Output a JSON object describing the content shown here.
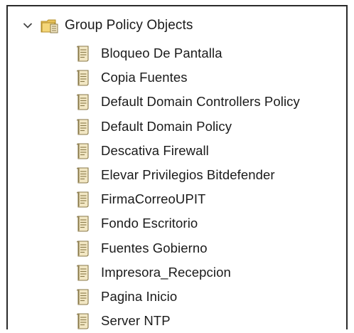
{
  "tree": {
    "root": {
      "label": "Group Policy Objects",
      "expanded": true,
      "icon": "folder-gpo-icon"
    },
    "items": [
      {
        "label": "Bloqueo De Pantalla",
        "icon": "gpo-document-icon"
      },
      {
        "label": "Copia Fuentes",
        "icon": "gpo-document-icon"
      },
      {
        "label": "Default Domain Controllers Policy",
        "icon": "gpo-document-icon"
      },
      {
        "label": "Default Domain Policy",
        "icon": "gpo-document-icon"
      },
      {
        "label": "Descativa Firewall",
        "icon": "gpo-document-icon"
      },
      {
        "label": "Elevar Privilegios Bitdefender",
        "icon": "gpo-document-icon"
      },
      {
        "label": "FirmaCorreoUPIT",
        "icon": "gpo-document-icon"
      },
      {
        "label": "Fondo Escritorio",
        "icon": "gpo-document-icon"
      },
      {
        "label": "Fuentes Gobierno",
        "icon": "gpo-document-icon"
      },
      {
        "label": "Impresora_Recepcion",
        "icon": "gpo-document-icon"
      },
      {
        "label": "Pagina Inicio",
        "icon": "gpo-document-icon"
      },
      {
        "label": "Server NTP",
        "icon": "gpo-document-icon"
      }
    ]
  },
  "colors": {
    "text": "#1a1a1a",
    "border": "#2b2b2b",
    "chevron": "#444444",
    "folder": "#e8c25a",
    "scroll_paper": "#f2e7c4",
    "scroll_outline": "#8a7a4a"
  }
}
